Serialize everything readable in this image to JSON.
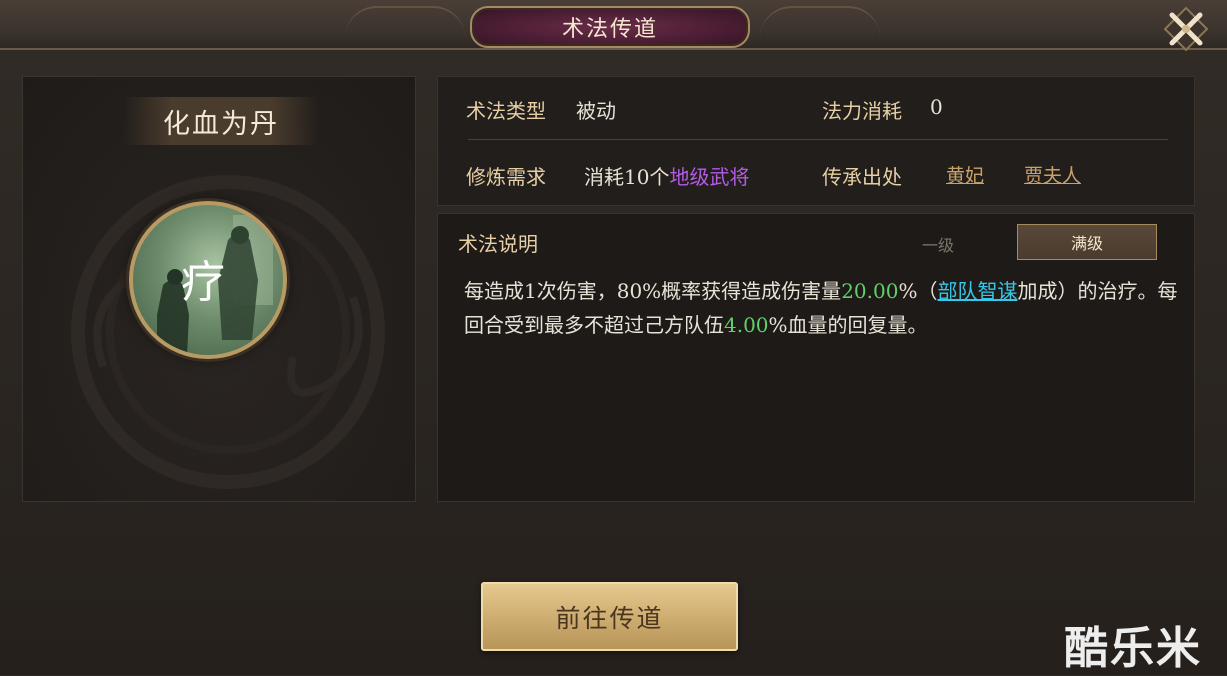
{
  "window": {
    "title": "术法传道",
    "close_icon": "close-x-icon"
  },
  "skill": {
    "name": "化血为丹",
    "icon_glyph": "疗",
    "icon": "healing-skill-icon"
  },
  "info": {
    "type_label": "术法类型",
    "type_value": "被动",
    "mana_label": "法力消耗",
    "mana_value": "0",
    "req_label": "修炼需求",
    "req_prefix": "消耗10个",
    "req_highlight": "地级武将",
    "source_label": "传承出处",
    "source_links": [
      "黄妃",
      "贾夫人"
    ]
  },
  "description": {
    "title": "术法说明",
    "tab_level1": "一级",
    "tab_max": "满级",
    "part1": "每造成1次伤害，80%概率获得造成伤害量",
    "value1": "20.00",
    "part2": "%（",
    "link": "部队智谋",
    "part3": "加成）的治疗。每回合受到最多不超过己方队伍",
    "value2": "4.00",
    "part4": "%血量的回复量。"
  },
  "action": {
    "go_button": "前往传道"
  },
  "watermark": "酷乐米",
  "colors": {
    "title_plate": "#4a1d33",
    "accent_gold": "#cfae72",
    "highlight_purple": "#b45ce6",
    "highlight_green": "#5fd06a",
    "highlight_cyan": "#35c8e8"
  }
}
